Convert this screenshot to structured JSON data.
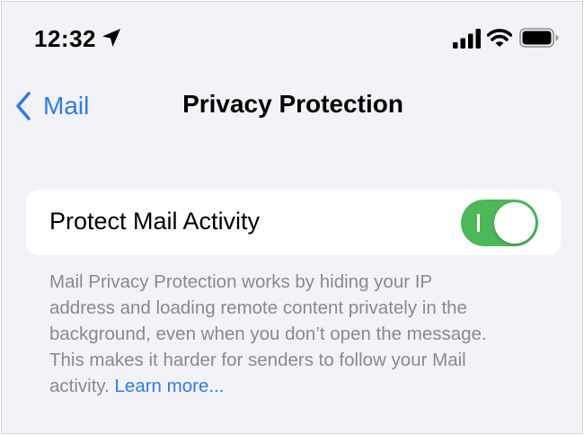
{
  "status_bar": {
    "time": "12:32",
    "icons": [
      "location-arrow-icon",
      "cellular-signal-icon",
      "wifi-icon",
      "battery-icon"
    ]
  },
  "nav": {
    "back_label": "Mail",
    "title": "Privacy Protection"
  },
  "settings": {
    "protect_mail_activity": {
      "label": "Protect Mail Activity",
      "enabled": true
    }
  },
  "footer": {
    "line_1": "Mail Privacy Protection works by hiding your IP",
    "line_2": "address and loading remote content privately in the",
    "line_3": "background, even when you don’t open the message.",
    "line_4": "This makes it harder for senders to follow your Mail",
    "line_5": "activity.",
    "learn_more": "Learn more..."
  },
  "colors": {
    "accent_blue": "#2f7ce6",
    "toggle_green": "#4cb85a",
    "background": "#f2f2f7",
    "secondary_text": "#8a8a8e"
  }
}
